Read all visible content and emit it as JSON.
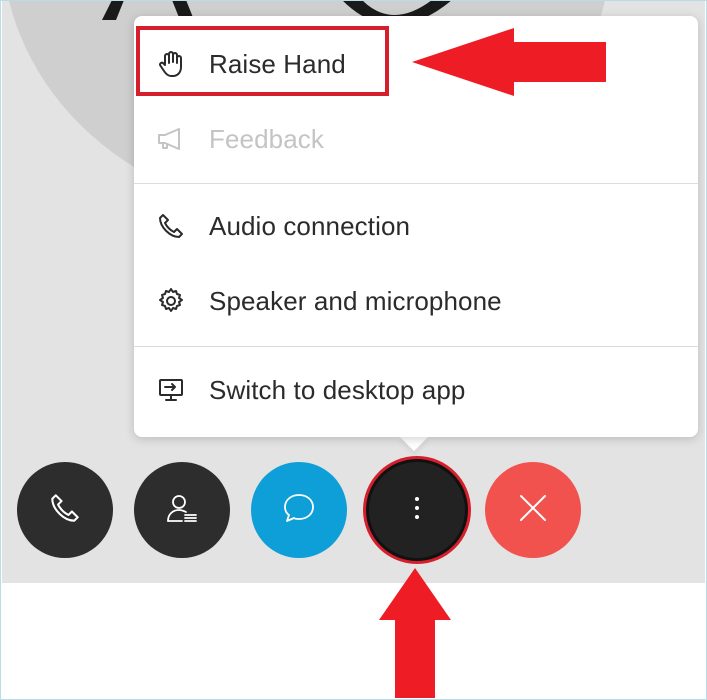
{
  "menu": {
    "items": [
      {
        "label": "Raise Hand",
        "icon": "hand-icon",
        "enabled": true
      },
      {
        "label": "Feedback",
        "icon": "megaphone-icon",
        "enabled": false
      },
      {
        "label": "Audio connection",
        "icon": "phone-icon",
        "enabled": true
      },
      {
        "label": "Speaker and microphone",
        "icon": "gear-icon",
        "enabled": true
      },
      {
        "label": "Switch to desktop app",
        "icon": "desktop-switch-icon",
        "enabled": true
      }
    ]
  },
  "controls": [
    {
      "name": "audio",
      "icon": "phone-icon",
      "color": "#2d2d2d"
    },
    {
      "name": "participants",
      "icon": "participants-icon",
      "color": "#2d2d2d"
    },
    {
      "name": "chat",
      "icon": "chat-icon",
      "color": "#0e9fd8"
    },
    {
      "name": "more",
      "icon": "more-vertical-icon",
      "color": "#222222"
    },
    {
      "name": "leave",
      "icon": "close-icon",
      "color": "#f2524d"
    }
  ],
  "annotations": {
    "highlight_color": "#d61f2c",
    "arrow_color": "#ee1c24"
  }
}
